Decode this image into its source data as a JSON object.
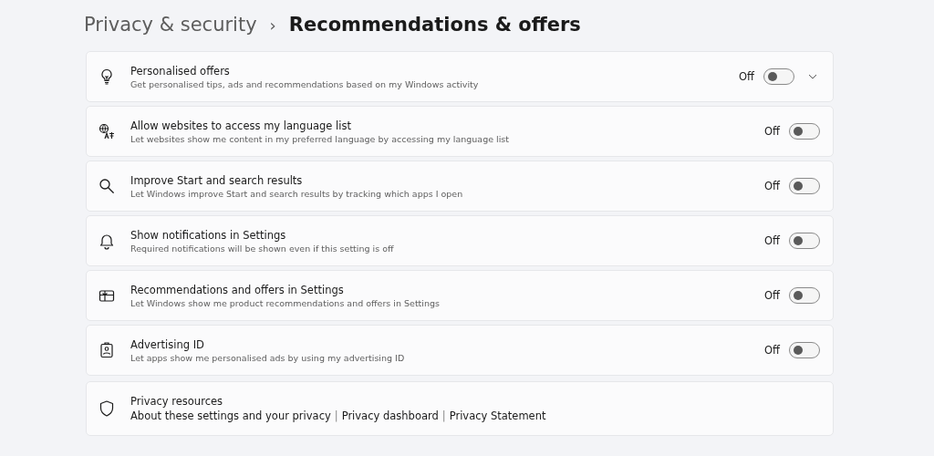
{
  "breadcrumb": {
    "parent": "Privacy & security",
    "separator": "›",
    "current": "Recommendations & offers"
  },
  "settings": [
    {
      "kind": "expander",
      "title": "Personalised offers",
      "description": "Get personalised tips, ads and recommendations based on my Windows activity",
      "state_label": "Off",
      "on": false,
      "expanded": false
    },
    {
      "kind": "toggle",
      "title": "Allow websites to access my language list",
      "description": "Let websites show me content in my preferred language by accessing my language list",
      "state_label": "Off",
      "on": false
    },
    {
      "kind": "toggle",
      "title": "Improve Start and search results",
      "description": "Let Windows improve Start and search results by tracking which apps I open",
      "state_label": "Off",
      "on": false
    },
    {
      "kind": "toggle",
      "title": "Show notifications in Settings",
      "description": "Required notifications will be shown even if this setting is off",
      "state_label": "Off",
      "on": false
    },
    {
      "kind": "toggle",
      "title": "Recommendations and offers in Settings",
      "description": "Let Windows show me product recommendations and offers in Settings",
      "state_label": "Off",
      "on": false
    },
    {
      "kind": "toggle",
      "title": "Advertising ID",
      "description": "Let apps show me personalised ads by using my advertising ID",
      "state_label": "Off",
      "on": false
    }
  ],
  "resources": {
    "title": "Privacy resources",
    "links": [
      {
        "label": "About these settings and your privacy"
      },
      {
        "separator": "|",
        "label": "Privacy dashboard"
      },
      {
        "separator": "|",
        "label": "Privacy Statement"
      }
    ]
  }
}
